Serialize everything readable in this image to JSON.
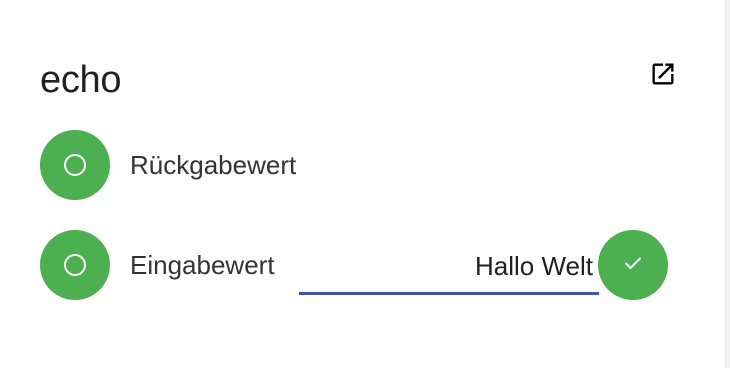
{
  "card": {
    "title": "echo",
    "open_icon": "open-in-new-icon"
  },
  "outputs": [
    {
      "label": "Rückgabewert",
      "status_icon": "circle-outline-icon",
      "status_color": "#4caf50"
    }
  ],
  "inputs": [
    {
      "label": "Eingabewert",
      "status_icon": "circle-outline-icon",
      "status_color": "#4caf50",
      "value": "Hallo Welt",
      "underline_color": "#3f51b5",
      "confirm_icon": "check-icon",
      "confirm_color": "#4caf50"
    }
  ]
}
